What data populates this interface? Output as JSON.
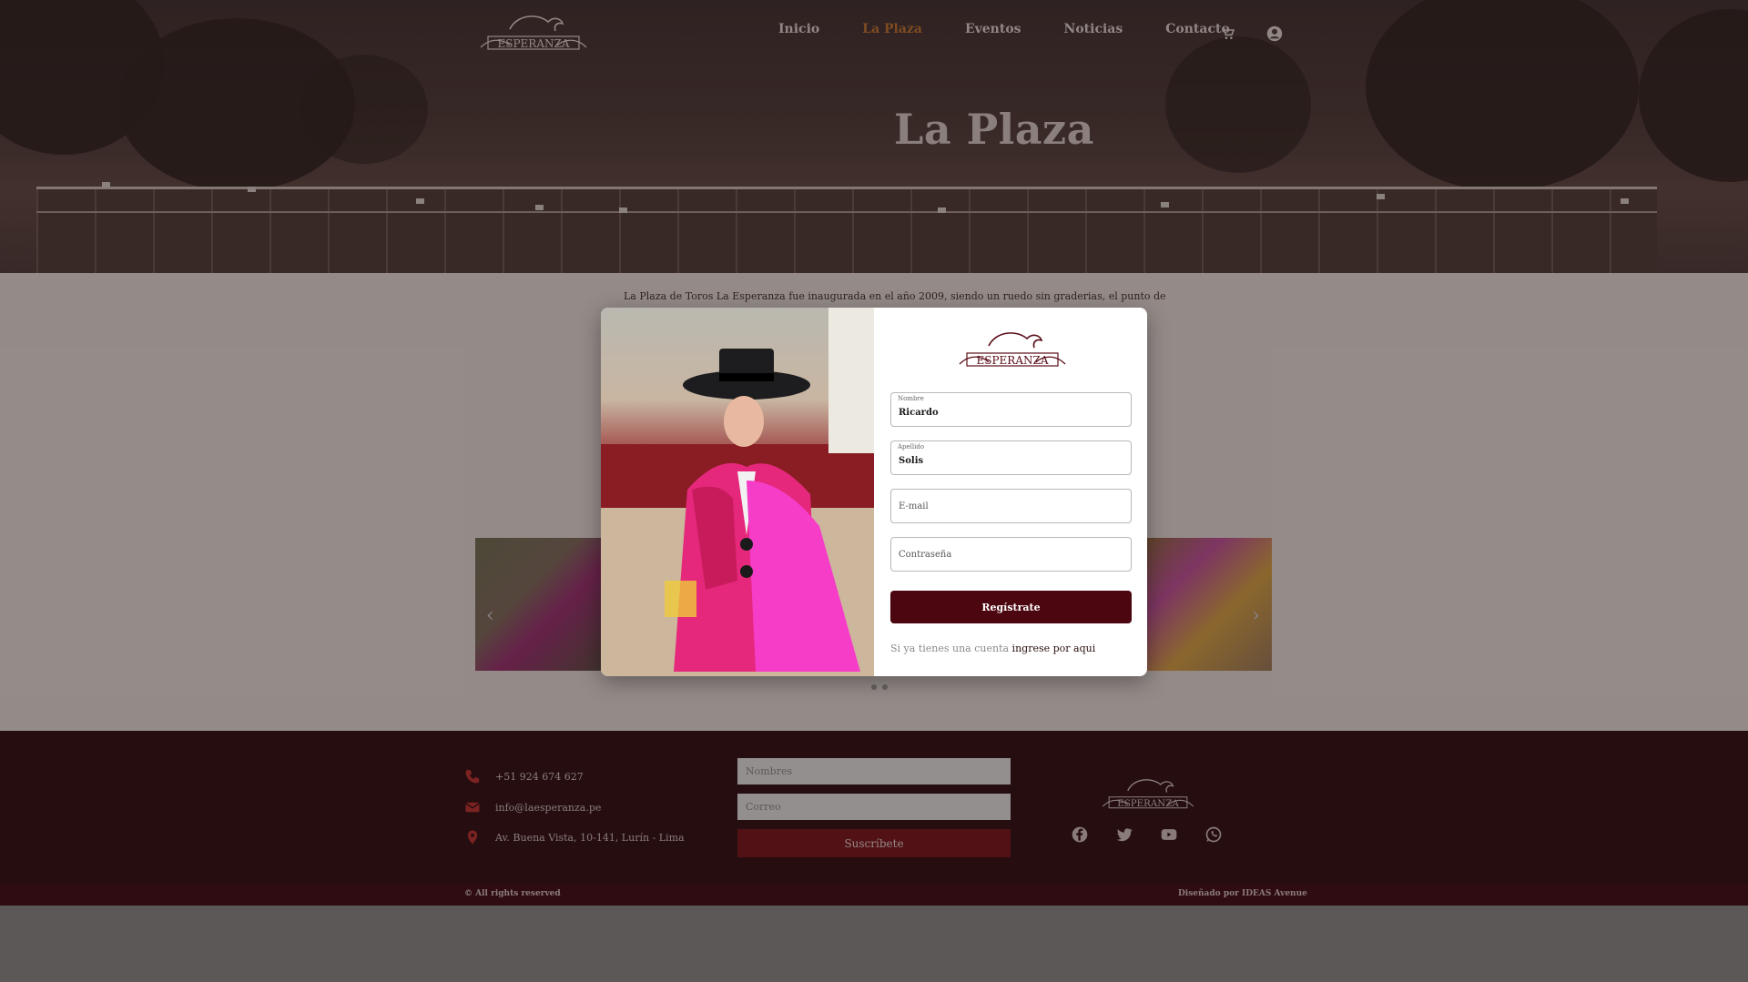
{
  "brand": {
    "logo_text": "ESPERANZA",
    "accent": "#c2752c",
    "dark": "#4c0610"
  },
  "nav": {
    "items": [
      {
        "label": "Inicio",
        "active": false
      },
      {
        "label": "La Plaza",
        "active": true
      },
      {
        "label": "Eventos",
        "active": false
      },
      {
        "label": "Noticias",
        "active": false
      },
      {
        "label": "Contacto",
        "active": false
      }
    ],
    "icons": [
      "cart-icon",
      "user-icon"
    ]
  },
  "hero": {
    "title": "La Plaza"
  },
  "content": {
    "intro": "La Plaza de Toros La Esperanza fue inaugurada en el año 2009, siendo un ruedo sin graderias, el punto de"
  },
  "modal": {
    "fields": {
      "nombre": {
        "label": "Nombre",
        "value": "Ricardo"
      },
      "apellido": {
        "label": "Apellido",
        "value": "Solis"
      },
      "email": {
        "placeholder": "E-mail"
      },
      "password": {
        "placeholder": "Contraseña"
      }
    },
    "register_label": "Regístrate",
    "login_prefix": "Si ya tienes una cuenta",
    "login_link": "ingrese por aqui"
  },
  "footer": {
    "phone": "+51 924 674 627",
    "email": "info@laesperanza.pe",
    "address": "Av. Buena Vista, 10-141, Lurín - Lima",
    "newsletter": {
      "name_placeholder": "Nombres",
      "email_placeholder": "Correo",
      "button": "Suscríbete"
    },
    "social": [
      "facebook-icon",
      "twitter-icon",
      "youtube-icon",
      "whatsapp-icon"
    ],
    "copyright": "© All rights reserved",
    "credits": "Diseñado por IDEAS Avenue"
  }
}
